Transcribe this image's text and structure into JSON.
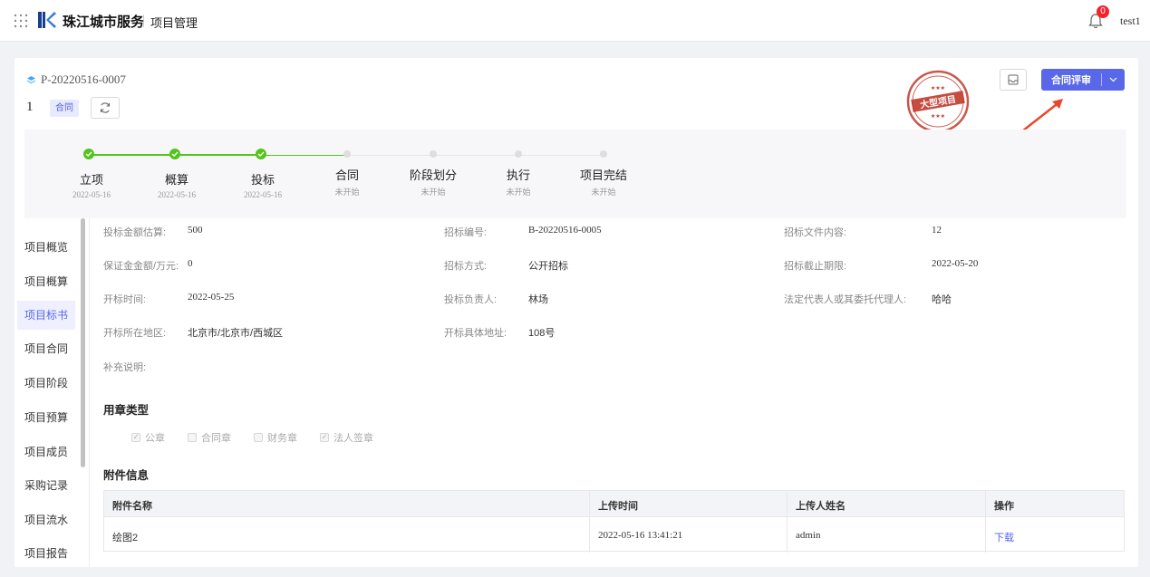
{
  "header": {
    "brand": "珠江城市服务",
    "module": "项目管理",
    "notification_count": "0",
    "user": "test1"
  },
  "project": {
    "code": "P-20220516-0007",
    "number": "1",
    "tag": "合同",
    "stamp_text": "大型项目",
    "review_button": "合同评审"
  },
  "steps": [
    {
      "title": "立项",
      "sub": "2022-05-16",
      "status": "done"
    },
    {
      "title": "概算",
      "sub": "2022-05-16",
      "status": "done"
    },
    {
      "title": "投标",
      "sub": "2022-05-16",
      "status": "done"
    },
    {
      "title": "合同",
      "sub": "未开始",
      "status": "todo"
    },
    {
      "title": "阶段划分",
      "sub": "未开始",
      "status": "todo"
    },
    {
      "title": "执行",
      "sub": "未开始",
      "status": "todo"
    },
    {
      "title": "项目完结",
      "sub": "未开始",
      "status": "todo"
    }
  ],
  "sidebar": {
    "items": [
      "项目概览",
      "项目概算",
      "项目标书",
      "项目合同",
      "项目阶段",
      "项目预算",
      "项目成员",
      "采购记录",
      "项目流水",
      "项目报告"
    ],
    "active": "项目标书"
  },
  "fields": {
    "bid_estimate_label": "投标金额估算:",
    "bid_estimate": "500",
    "bid_no_label": "招标编号:",
    "bid_no": "B-20220516-0005",
    "bid_doc_label": "招标文件内容:",
    "bid_doc": "12",
    "deposit_label": "保证金金额/万元:",
    "deposit": "0",
    "bid_method_label": "招标方式:",
    "bid_method": "公开招标",
    "deadline_label": "招标截止期限:",
    "deadline": "2022-05-20",
    "open_time_label": "开标时间:",
    "open_time": "2022-05-25",
    "bid_owner_label": "投标负责人:",
    "bid_owner": "林场",
    "legal_rep_label": "法定代表人或其委托代理人:",
    "legal_rep": "哈哈",
    "region_label": "开标所在地区:",
    "region": "北京市/北京市/西城区",
    "address_label": "开标具体地址:",
    "address": "108号",
    "note_label": "补充说明:"
  },
  "seal": {
    "title": "用章类型",
    "options": [
      {
        "label": "公章",
        "checked": true
      },
      {
        "label": "合同章",
        "checked": false
      },
      {
        "label": "财务章",
        "checked": false
      },
      {
        "label": "法人签章",
        "checked": true
      }
    ]
  },
  "attachments": {
    "title": "附件信息",
    "columns": [
      "附件名称",
      "上传时间",
      "上传人姓名",
      "操作"
    ],
    "rows": [
      {
        "name": "绘图2",
        "time": "2022-05-16 13:41:21",
        "uploader": "admin",
        "action": "下载"
      }
    ]
  },
  "colors": {
    "primary": "#5868e8",
    "success": "#52c41a",
    "stamp": "#c0392b"
  }
}
